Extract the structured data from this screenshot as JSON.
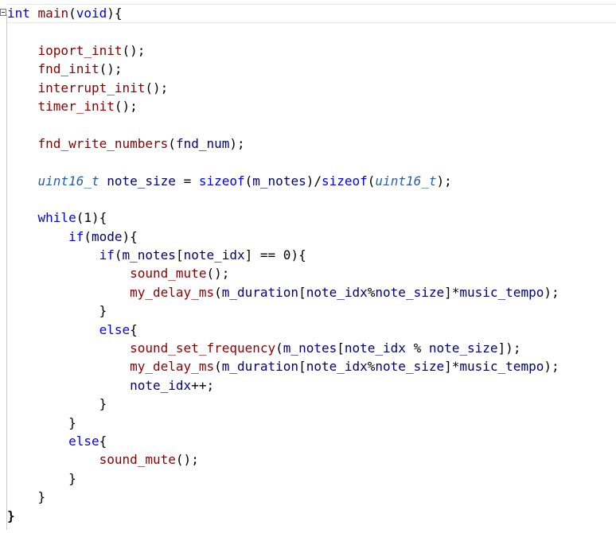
{
  "editor": {
    "lines": [
      [
        {
          "t": "kw",
          "v": "int"
        },
        {
          "t": "pun",
          "v": " "
        },
        {
          "t": "fn",
          "v": "main"
        },
        {
          "t": "pun",
          "v": "("
        },
        {
          "t": "kw",
          "v": "void"
        },
        {
          "t": "pun",
          "v": "){"
        }
      ],
      [],
      [
        {
          "t": "pun",
          "v": "    "
        },
        {
          "t": "fn",
          "v": "ioport_init"
        },
        {
          "t": "pun",
          "v": "();"
        }
      ],
      [
        {
          "t": "pun",
          "v": "    "
        },
        {
          "t": "fn",
          "v": "fnd_init"
        },
        {
          "t": "pun",
          "v": "();"
        }
      ],
      [
        {
          "t": "pun",
          "v": "    "
        },
        {
          "t": "fn",
          "v": "interrupt_init"
        },
        {
          "t": "pun",
          "v": "();"
        }
      ],
      [
        {
          "t": "pun",
          "v": "    "
        },
        {
          "t": "fn",
          "v": "timer_init"
        },
        {
          "t": "pun",
          "v": "();"
        }
      ],
      [],
      [
        {
          "t": "pun",
          "v": "    "
        },
        {
          "t": "fn",
          "v": "fnd_write_numbers"
        },
        {
          "t": "pun",
          "v": "("
        },
        {
          "t": "var",
          "v": "fnd_num"
        },
        {
          "t": "pun",
          "v": ");"
        }
      ],
      [],
      [
        {
          "t": "pun",
          "v": "    "
        },
        {
          "t": "typ",
          "v": "uint16_t"
        },
        {
          "t": "pun",
          "v": " "
        },
        {
          "t": "var",
          "v": "note_size"
        },
        {
          "t": "pun",
          "v": " = "
        },
        {
          "t": "kw",
          "v": "sizeof"
        },
        {
          "t": "pun",
          "v": "("
        },
        {
          "t": "var",
          "v": "m_notes"
        },
        {
          "t": "pun",
          "v": ")/"
        },
        {
          "t": "kw",
          "v": "sizeof"
        },
        {
          "t": "pun",
          "v": "("
        },
        {
          "t": "typ",
          "v": "uint16_t"
        },
        {
          "t": "pun",
          "v": ");"
        }
      ],
      [],
      [
        {
          "t": "pun",
          "v": "    "
        },
        {
          "t": "kw",
          "v": "while"
        },
        {
          "t": "pun",
          "v": "(1){"
        }
      ],
      [
        {
          "t": "pun",
          "v": "        "
        },
        {
          "t": "kw",
          "v": "if"
        },
        {
          "t": "pun",
          "v": "("
        },
        {
          "t": "var",
          "v": "mode"
        },
        {
          "t": "pun",
          "v": "){"
        }
      ],
      [
        {
          "t": "pun",
          "v": "            "
        },
        {
          "t": "kw",
          "v": "if"
        },
        {
          "t": "pun",
          "v": "("
        },
        {
          "t": "var",
          "v": "m_notes"
        },
        {
          "t": "pun",
          "v": "["
        },
        {
          "t": "var",
          "v": "note_idx"
        },
        {
          "t": "pun",
          "v": "] == 0){"
        }
      ],
      [
        {
          "t": "pun",
          "v": "                "
        },
        {
          "t": "fn",
          "v": "sound_mute"
        },
        {
          "t": "pun",
          "v": "();"
        }
      ],
      [
        {
          "t": "pun",
          "v": "                "
        },
        {
          "t": "fn",
          "v": "my_delay_ms"
        },
        {
          "t": "pun",
          "v": "("
        },
        {
          "t": "var",
          "v": "m_duration"
        },
        {
          "t": "pun",
          "v": "["
        },
        {
          "t": "var",
          "v": "note_idx"
        },
        {
          "t": "pun",
          "v": "%"
        },
        {
          "t": "var",
          "v": "note_size"
        },
        {
          "t": "pun",
          "v": "]*"
        },
        {
          "t": "var",
          "v": "music_tempo"
        },
        {
          "t": "pun",
          "v": ");"
        }
      ],
      [
        {
          "t": "pun",
          "v": "            }"
        }
      ],
      [
        {
          "t": "pun",
          "v": "            "
        },
        {
          "t": "kw",
          "v": "else"
        },
        {
          "t": "pun",
          "v": "{"
        }
      ],
      [
        {
          "t": "pun",
          "v": "                "
        },
        {
          "t": "fn",
          "v": "sound_set_frequency"
        },
        {
          "t": "pun",
          "v": "("
        },
        {
          "t": "var",
          "v": "m_notes"
        },
        {
          "t": "pun",
          "v": "["
        },
        {
          "t": "var",
          "v": "note_idx"
        },
        {
          "t": "pun",
          "v": " % "
        },
        {
          "t": "var",
          "v": "note_size"
        },
        {
          "t": "pun",
          "v": "]);"
        }
      ],
      [
        {
          "t": "pun",
          "v": "                "
        },
        {
          "t": "fn",
          "v": "my_delay_ms"
        },
        {
          "t": "pun",
          "v": "("
        },
        {
          "t": "var",
          "v": "m_duration"
        },
        {
          "t": "pun",
          "v": "["
        },
        {
          "t": "var",
          "v": "note_idx"
        },
        {
          "t": "pun",
          "v": "%"
        },
        {
          "t": "var",
          "v": "note_size"
        },
        {
          "t": "pun",
          "v": "]*"
        },
        {
          "t": "var",
          "v": "music_tempo"
        },
        {
          "t": "pun",
          "v": ");"
        }
      ],
      [
        {
          "t": "pun",
          "v": "                "
        },
        {
          "t": "var",
          "v": "note_idx"
        },
        {
          "t": "pun",
          "v": "++;"
        }
      ],
      [
        {
          "t": "pun",
          "v": "            }"
        }
      ],
      [
        {
          "t": "pun",
          "v": "        }"
        }
      ],
      [
        {
          "t": "pun",
          "v": "        "
        },
        {
          "t": "kw",
          "v": "else"
        },
        {
          "t": "pun",
          "v": "{"
        }
      ],
      [
        {
          "t": "pun",
          "v": "            "
        },
        {
          "t": "fn",
          "v": "sound_mute"
        },
        {
          "t": "pun",
          "v": "();"
        }
      ],
      [
        {
          "t": "pun",
          "v": "        }"
        }
      ],
      [
        {
          "t": "pun",
          "v": "    }"
        }
      ],
      [
        {
          "t": "pun",
          "v": "}"
        }
      ]
    ]
  },
  "colors": {
    "keyword": "#0000ff",
    "function": "#8b0000",
    "variable": "#000080",
    "type": "#2b5ea8",
    "punctuation": "#000000",
    "background": "#ffffff"
  },
  "icons": {
    "fold": "collapse-icon"
  }
}
